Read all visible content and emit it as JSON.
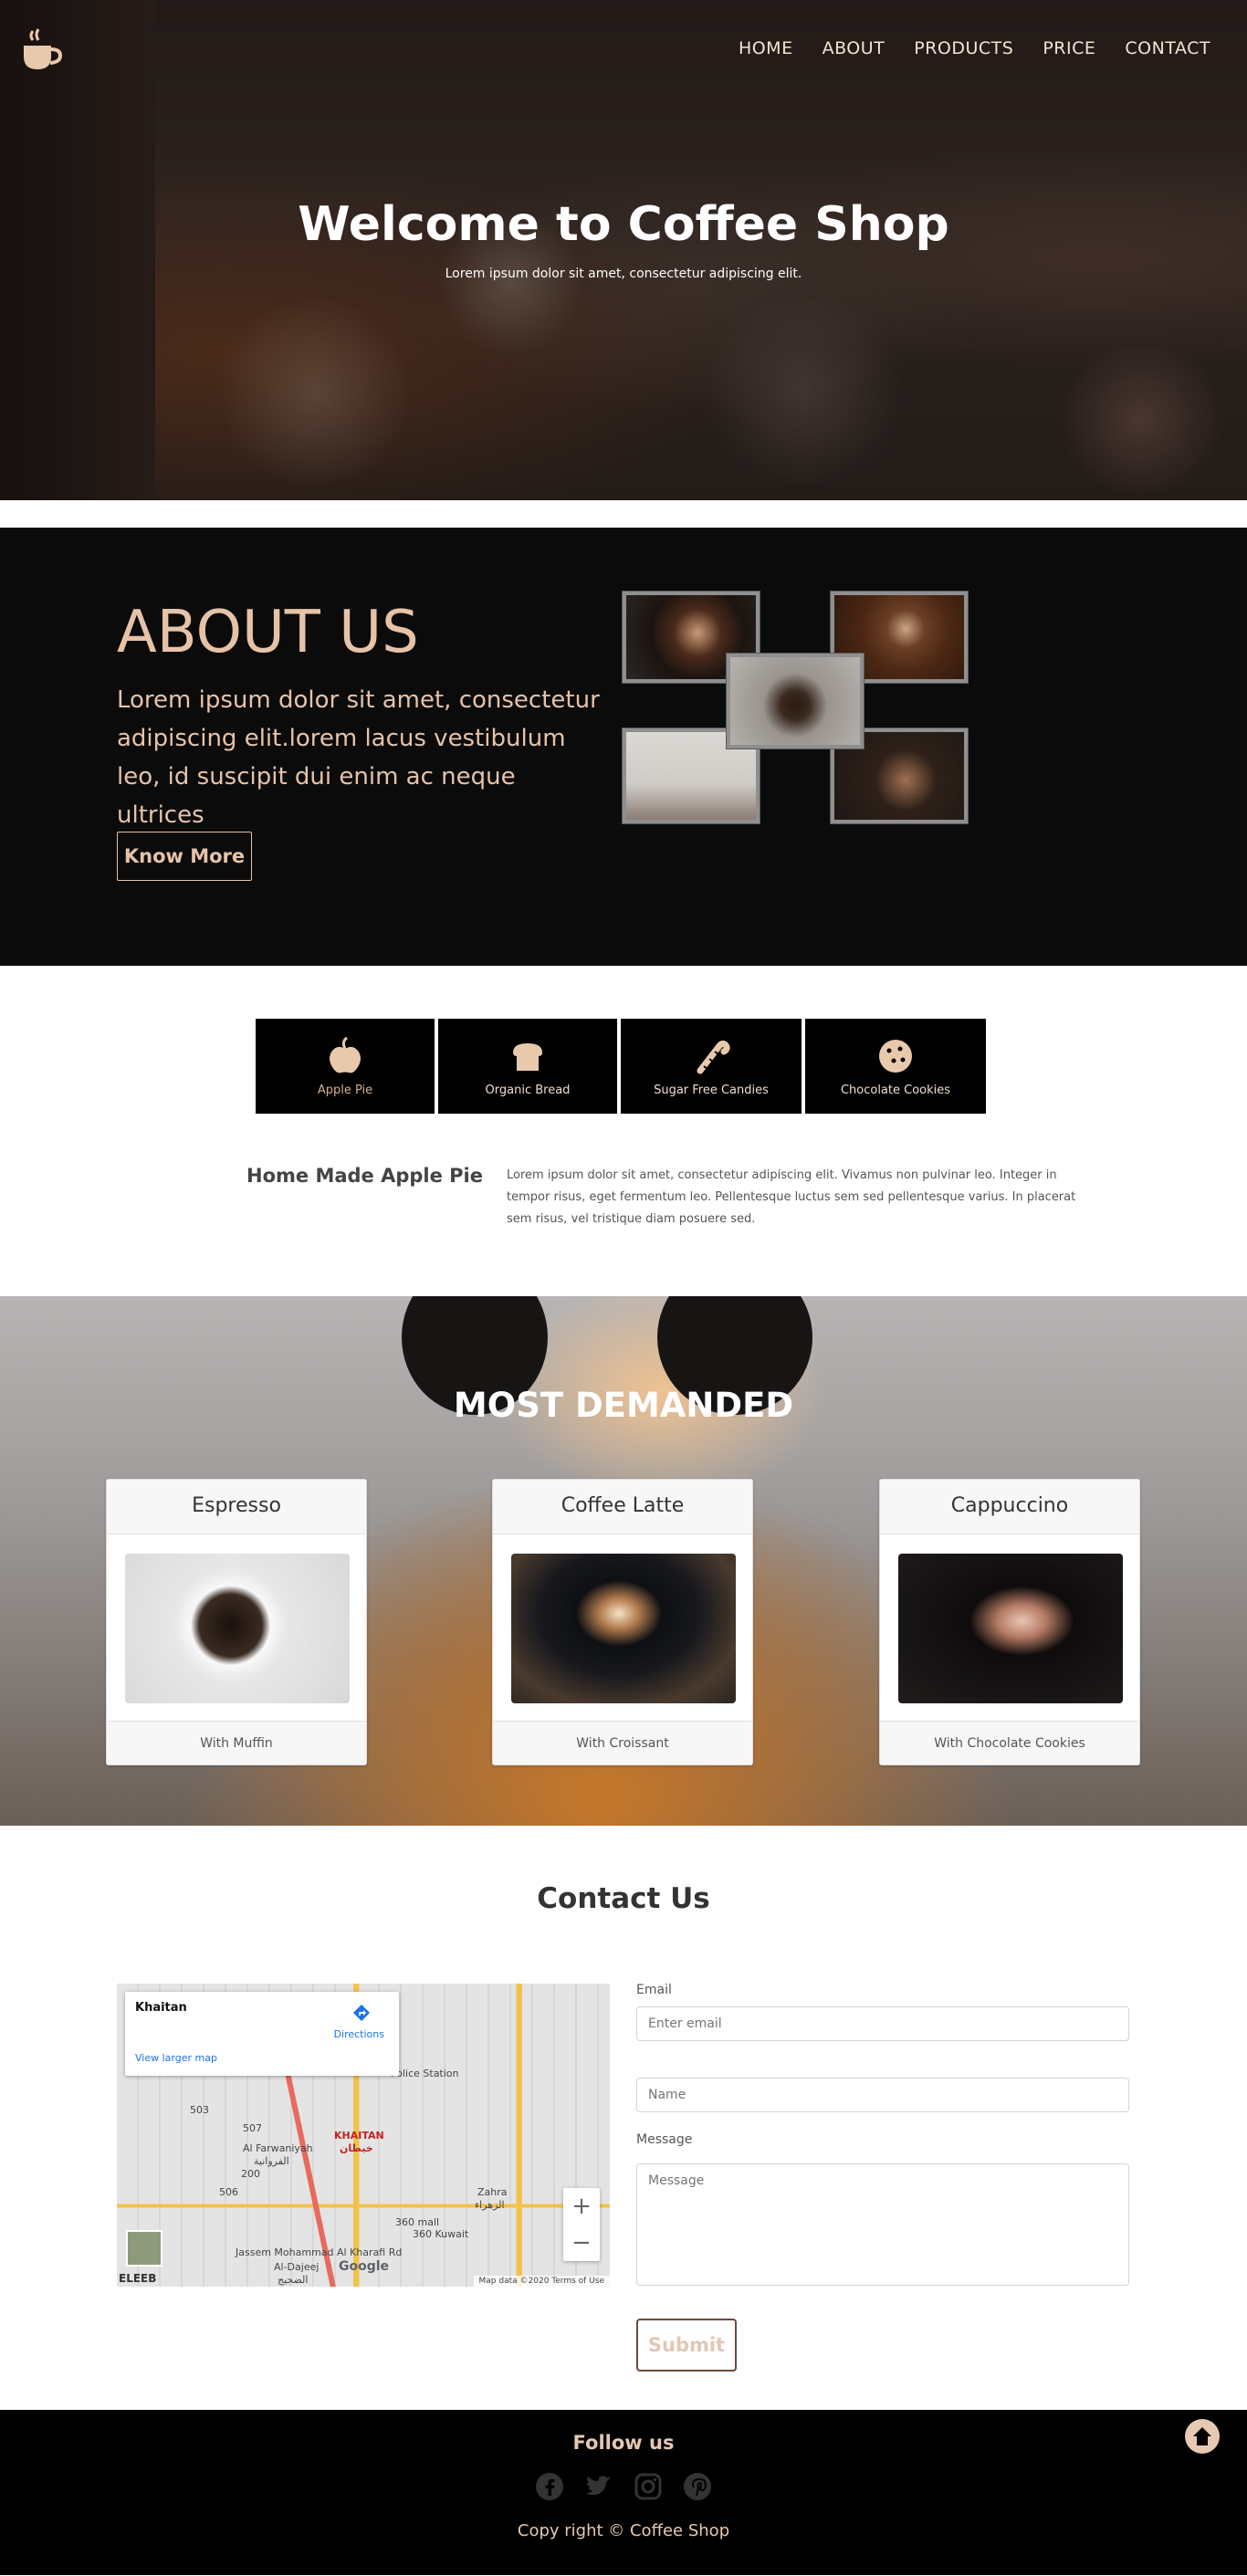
{
  "header": {
    "logo": "coffee-cup-icon",
    "nav": [
      "HOME",
      "ABOUT",
      "PRODUCTS",
      "PRICE",
      "CONTACT"
    ],
    "title": "Welcome to Coffee Shop",
    "subtitle": "Lorem ipsum dolor sit amet, consectetur adipiscing elit."
  },
  "about": {
    "title": "ABOUT US",
    "text": "Lorem ipsum dolor sit amet, consectetur adipiscing elit.lorem lacus vestibulum leo, id suscipit dui enim ac neque ultrices",
    "button": "Know More"
  },
  "products": {
    "tabs": [
      {
        "label": "Apple Pie",
        "icon": "apple-icon"
      },
      {
        "label": "Organic Bread",
        "icon": "bread-icon"
      },
      {
        "label": "Sugar Free Candies",
        "icon": "candy-cane-icon"
      },
      {
        "label": "Chocolate Cookies",
        "icon": "cookie-icon"
      }
    ],
    "active_title": "Home Made Apple Pie",
    "active_text": "Lorem ipsum dolor sit amet, consectetur adipiscing elit. Vivamus non pulvinar leo. Integer in tempor risus, eget fermentum leo. Pellentesque luctus sem sed pellentesque varius. In placerat sem risus, vel tristique diam posuere sed."
  },
  "demanded": {
    "title": "MOST DEMANDED",
    "items": [
      {
        "name": "Espresso",
        "footer": "With Muffin"
      },
      {
        "name": "Coffee Latte",
        "footer": "With Croissant"
      },
      {
        "name": "Cappuccino",
        "footer": "With Chocolate Cookies"
      }
    ]
  },
  "contact": {
    "title": "Contact Us",
    "map": {
      "place": "Khaitan",
      "directions": "Directions",
      "larger": "View larger map",
      "labels": {
        "police": "Police Station",
        "farwaniyah": "Al Farwaniyah",
        "farwaniyah_ar": "الفروانية",
        "khaitan": "KHAITAN",
        "khaitan_ar": "خيطان",
        "zahra": "Zahra",
        "zahra_ar": "الزهراء",
        "mall": "360 mall",
        "mall_ar": "360 Kuwait",
        "jassem": "Jassem Mohammad Al Kharafi Rd",
        "dajeej": "Al-Dajeej",
        "dajeej_ar": "الضجيج",
        "eleeb": "ELEEB",
        "road_507": "507",
        "road_503": "503",
        "road_200": "200",
        "road_506": "506"
      },
      "google": "Google",
      "terms": "Map data ©2020    Terms of Use",
      "zoom_in": "+",
      "zoom_out": "−"
    },
    "email_label": "Email",
    "email_placeholder": "Enter email",
    "name_placeholder": "Name",
    "message_label": "Message",
    "message_placeholder": "Message",
    "submit": "Submit"
  },
  "footer": {
    "title": "Follow us",
    "social": [
      "facebook-icon",
      "twitter-icon",
      "instagram-icon",
      "pinterest-icon"
    ],
    "copyright": "Copy right © Coffee Shop"
  },
  "colors": {
    "accent": "#e6c3a8",
    "dark": "#0b0b0b"
  }
}
